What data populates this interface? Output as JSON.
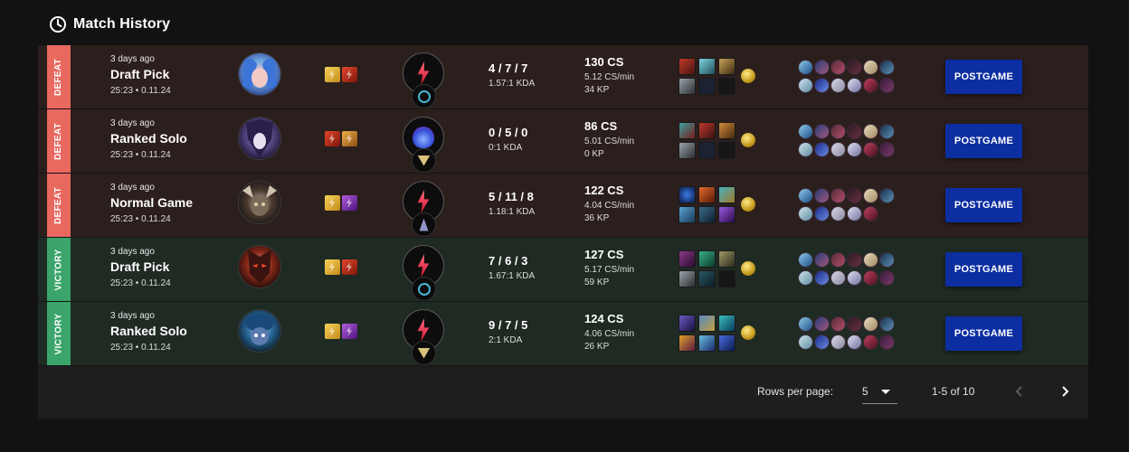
{
  "header": {
    "title": "Match History",
    "icon": "clock-icon"
  },
  "matches": [
    {
      "result": "DEFEAT",
      "ago": "3 days ago",
      "mode": "Draft Pick",
      "meta": "25:23 • 0.11.24",
      "kda": "4 / 7 / 7",
      "kda_ratio": "1.57:1 KDA",
      "cs": "130 CS",
      "cs_per_min": "5.12 CS/min",
      "kp": "34 KP",
      "button": "POSTGAME"
    },
    {
      "result": "DEFEAT",
      "ago": "3 days ago",
      "mode": "Ranked Solo",
      "meta": "25:23 • 0.11.24",
      "kda": "0 / 5 / 0",
      "kda_ratio": "0:1 KDA",
      "cs": "86 CS",
      "cs_per_min": "5.01 CS/min",
      "kp": "0 KP",
      "button": "POSTGAME"
    },
    {
      "result": "DEFEAT",
      "ago": "3 days ago",
      "mode": "Normal Game",
      "meta": "25:23 • 0.11.24",
      "kda": "5 / 11 / 8",
      "kda_ratio": "1.18:1 KDA",
      "cs": "122 CS",
      "cs_per_min": "4.04 CS/min",
      "kp": "36 KP",
      "button": "POSTGAME"
    },
    {
      "result": "VICTORY",
      "ago": "3 days ago",
      "mode": "Draft Pick",
      "meta": "25:23 • 0.11.24",
      "kda": "7 / 6 / 3",
      "kda_ratio": "1.67:1 KDA",
      "cs": "127 CS",
      "cs_per_min": "5.17 CS/min",
      "kp": "59 KP",
      "button": "POSTGAME"
    },
    {
      "result": "VICTORY",
      "ago": "3 days ago",
      "mode": "Ranked Solo",
      "meta": "25:23 • 0.11.24",
      "kda": "9 / 7 / 5",
      "kda_ratio": "2:1 KDA",
      "cs": "124 CS",
      "cs_per_min": "4.06 CS/min",
      "kp": "26 KP",
      "button": "POSTGAME"
    }
  ],
  "pagination": {
    "rows_per_page_label": "Rows per page:",
    "rows_per_page": "5",
    "range": "1-5 of 10"
  },
  "colors": {
    "defeat": "#e9685f",
    "victory": "#3aa46a",
    "button": "#0d2ea1"
  }
}
